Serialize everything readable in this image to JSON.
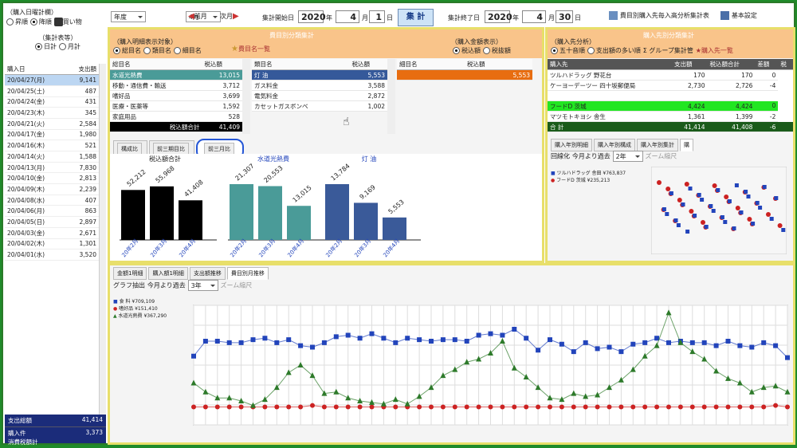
{
  "purchase_type": {
    "title": "（購入日曜計欄）",
    "opt1": "昇順",
    "opt2": "降順",
    "opt3": "買い物"
  },
  "period": {
    "year_mode": "年度",
    "month_sel": "4月",
    "prev": "前月",
    "next": "次月",
    "start_label": "集計開始日",
    "start_year": "2020",
    "start_month": "4",
    "start_day": "1",
    "year": "年",
    "month": "月",
    "day": "日",
    "aggregate": "集 計",
    "end_label": "集計終了日",
    "end_year": "2020",
    "end_month": "4",
    "end_day": "30"
  },
  "toolbar": {
    "calc_report": "費目別購入先毎入高分析集計表",
    "setup": "基本設定"
  },
  "left_panel": {
    "title": "（集計表等）",
    "opt1": "日計",
    "opt2": "月計",
    "col_date": "購入日",
    "col_amount": "支出額",
    "rows": [
      [
        "20/04/27(月)",
        "9,141"
      ],
      [
        "20/04/25(土)",
        "487"
      ],
      [
        "20/04/24(金)",
        "431"
      ],
      [
        "20/04/23(木)",
        "345"
      ],
      [
        "20/04/21(火)",
        "2,584"
      ],
      [
        "20/04/17(金)",
        "1,980"
      ],
      [
        "20/04/16(木)",
        "521"
      ],
      [
        "20/04/14(火)",
        "1,588"
      ],
      [
        "20/04/13(月)",
        "7,830"
      ],
      [
        "20/04/10(金)",
        "2,813"
      ],
      [
        "20/04/09(木)",
        "2,239"
      ],
      [
        "20/04/08(水)",
        "407"
      ],
      [
        "20/04/06(月)",
        "863"
      ],
      [
        "20/04/05(日)",
        "2,897"
      ],
      [
        "20/04/03(金)",
        "2,671"
      ],
      [
        "20/04/02(木)",
        "1,301"
      ],
      [
        "20/04/01(水)",
        "3,520"
      ]
    ],
    "total_label": "支出総額",
    "total_value": "41,414",
    "limit_label": "購入件\n消費税額計",
    "limit_value": "3,373"
  },
  "category_panel": {
    "title": "費目別分類集計",
    "mode_title": "（購入明細表示対象）",
    "mode1": "総目名",
    "mode2": "類目名",
    "mode3": "細目名",
    "list_button": "費目名一覧",
    "amount_title": "（購入金額表示）",
    "tax_in": "税込額",
    "tax_out": "税抜額",
    "col1_header": "総目名",
    "col2_header": "税込額",
    "col3_header": "類目名",
    "col4_header": "税込額",
    "col5_header": "細目名",
    "col6_header": "税込額",
    "t1": [
      [
        "水道光熱費",
        "13,015"
      ],
      [
        "移動・通信費・輸送",
        "3,712"
      ],
      [
        "嗜好品",
        "3,699"
      ],
      [
        "医療・医薬等",
        "1,592"
      ],
      [
        "家庭用品",
        "528"
      ]
    ],
    "t1_total_label": "税込額合計",
    "t1_total": "41,409",
    "t2": [
      [
        "灯 油",
        "5,553"
      ],
      [
        "ガス料金",
        "3,588"
      ],
      [
        "電気料金",
        "2,872"
      ],
      [
        "カセットガスボンベ",
        "1,002"
      ]
    ],
    "t3": [
      [
        "",
        "5,553"
      ]
    ],
    "tabs": [
      "構成比",
      "前三期目比",
      "前三月比"
    ],
    "chart_captions": [
      "税込額合計",
      "水道光熱費",
      "灯 油"
    ]
  },
  "purchase_panel": {
    "title": "購入先別分類集計",
    "mode_title": "（購入先分析）",
    "opt1": "五十音順",
    "opt2": "支出額の多い順",
    "group_btn": "グループ集計管",
    "list_btn": "購入先一覧",
    "headers": [
      "購入先",
      "支出額",
      "税込額合計",
      "差額",
      "税"
    ],
    "rows": [
      [
        "ツルハドラッグ 野花台",
        "170",
        "170",
        "0"
      ],
      [
        "ケーヨーデーツー 四十坂郵便局",
        "2,730",
        "2,726",
        "-4"
      ],
      [
        "",
        "",
        ""
      ],
      [
        "フードD 茨城",
        "4,424",
        "4,424",
        "0"
      ],
      [
        "マツモトキヨシ 舎生",
        "1,361",
        "1,399",
        "-2"
      ]
    ],
    "total_label": "合 計",
    "total_values": [
      "41,414",
      "41,408",
      "-6"
    ],
    "tabs": [
      "購入年別明細",
      "購入年別構成",
      "購入年別集計",
      "購"
    ],
    "graph_label": "回線化",
    "period_label": "今月より過去",
    "period_value": "2年",
    "zoom": "ズーム縮尺",
    "legend": [
      "ツルハドラッグ 舎田 ¥763,837",
      "フードD 茨城 ¥235,213"
    ]
  },
  "bottom_panel": {
    "tabs": [
      "金額1明細",
      "購入額1明細",
      "支出額推移",
      "費目別月推移"
    ],
    "graph_label": "グラフ抽出",
    "period_label": "今月より過去",
    "period_value": "3年",
    "zoom": "ズーム縮尺",
    "legend": [
      "食 料 ¥709,109",
      "嗜好品 ¥151,410",
      "水道光熱費 ¥367,290"
    ]
  },
  "colors": {
    "frame": "#1f8b2a",
    "pane_border": "#e8df6a",
    "header": "#f9c48a",
    "selected_row": "#4a9b98",
    "blue_series": "#2244bb",
    "green_series": "#2d7a2a",
    "red_series": "#cc2222"
  },
  "chart_data": [
    {
      "type": "bar",
      "title": "税込額合計",
      "categories": [
        "20年2月",
        "20年3月",
        "20年4月"
      ],
      "values": [
        52212,
        55968,
        41408
      ]
    },
    {
      "type": "bar",
      "title": "水道光熱費",
      "categories": [
        "20年2月",
        "20年3月",
        "20年4月"
      ],
      "values": [
        21307,
        20553,
        13015
      ]
    },
    {
      "type": "bar",
      "title": "灯 油",
      "categories": [
        "20年2月",
        "20年3月",
        "20年4月"
      ],
      "values": [
        13784,
        9169,
        5553
      ]
    },
    {
      "type": "line",
      "series": [
        {
          "name": "食 料",
          "values": [
            46,
            56,
            56,
            55,
            55,
            57,
            58,
            55,
            57,
            53,
            52,
            55,
            59,
            60,
            58,
            61,
            58,
            55,
            58,
            57,
            56,
            57,
            57,
            56,
            60,
            61,
            60,
            64,
            58,
            50,
            57,
            54,
            49,
            55,
            51,
            52,
            49,
            54,
            55,
            58,
            55,
            56,
            55,
            55,
            53,
            56,
            53,
            52,
            55,
            53,
            45
          ]
        },
        {
          "name": "嗜好品",
          "values": [
            12,
            12,
            12,
            12,
            12,
            12,
            12,
            12,
            12,
            12,
            13,
            12,
            12,
            12,
            12,
            12,
            12,
            12,
            12,
            12,
            12,
            12,
            12,
            12,
            12,
            12,
            12,
            12,
            12,
            12,
            12,
            12,
            12,
            12,
            12,
            12,
            12,
            12,
            12,
            12,
            12,
            12,
            12,
            12,
            12,
            12,
            12,
            12,
            12,
            13,
            12
          ]
        },
        {
          "name": "水道光熱費",
          "values": [
            28,
            22,
            18,
            18,
            16,
            13,
            17,
            25,
            35,
            40,
            33,
            21,
            22,
            18,
            16,
            15,
            14,
            17,
            14,
            19,
            25,
            33,
            37,
            42,
            44,
            48,
            56,
            38,
            32,
            25,
            18,
            17,
            21,
            19,
            20,
            25,
            30,
            37,
            46,
            53,
            75,
            55,
            49,
            44,
            36,
            31,
            28,
            22,
            25,
            26,
            22
          ]
        }
      ]
    }
  ]
}
